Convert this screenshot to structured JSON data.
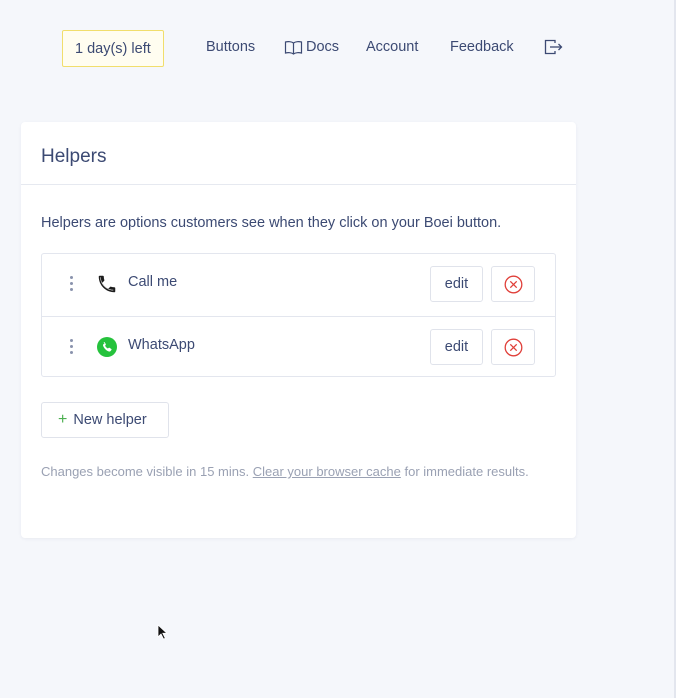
{
  "nav": {
    "trial_badge": "1 day(s) left",
    "links": {
      "buttons": "Buttons",
      "docs": "Docs",
      "account": "Account",
      "feedback": "Feedback"
    },
    "icons": {
      "docs": "book-icon",
      "logout": "logout-icon"
    }
  },
  "card": {
    "title": "Helpers",
    "description": "Helpers are options customers see when they click on your Boei button.",
    "helpers": [
      {
        "label": "Call me",
        "icon": "phone-icon",
        "edit_label": "edit"
      },
      {
        "label": "WhatsApp",
        "icon": "whatsapp-icon",
        "icon_color": "#25c23c",
        "edit_label": "edit"
      }
    ],
    "new_helper_label": "New helper",
    "note": {
      "prefix": "Changes become visible in 15 mins. ",
      "link": "Clear your browser cache",
      "suffix": " for immediate results."
    }
  },
  "colors": {
    "accent_text": "#3c4a73",
    "badge_border": "#f1de6c",
    "delete_red": "#e0403a",
    "plus_green": "#4caf50"
  }
}
